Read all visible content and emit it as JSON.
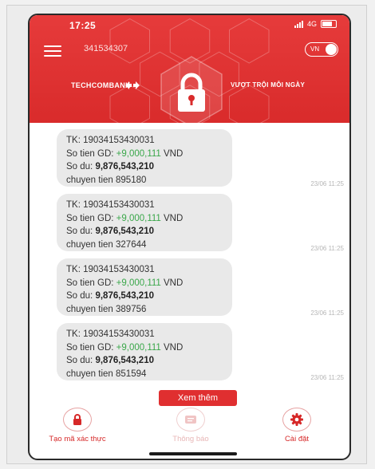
{
  "status_bar": {
    "time": "17:25",
    "network": "4G"
  },
  "header": {
    "account_number": "341534307",
    "language_toggle": "VN",
    "bank_name": "TECHCOMBANK",
    "slogan": "VƯỢT TRỘI MỖI NGÀY",
    "brand_color": "#e0302f"
  },
  "messages": [
    {
      "line_tk": "TK: 19034153430031",
      "gd_label": "So tien GD: ",
      "gd_amount": "+9,000,111",
      "gd_currency": " VND",
      "du_label": "So du: ",
      "balance": "9,876,543,210",
      "description": "chuyen tien 895180",
      "time": "23/06 11:25"
    },
    {
      "line_tk": "TK: 19034153430031",
      "gd_label": "So tien GD: ",
      "gd_amount": "+9,000,111",
      "gd_currency": " VND",
      "du_label": "So du: ",
      "balance": "9,876,543,210",
      "description": "chuyen tien 327644",
      "time": "23/06 11:25"
    },
    {
      "line_tk": "TK: 19034153430031",
      "gd_label": "So tien GD: ",
      "gd_amount": "+9,000,111",
      "gd_currency": " VND",
      "du_label": "So du: ",
      "balance": "9,876,543,210",
      "description": "chuyen tien 389756",
      "time": "23/06 11:25"
    },
    {
      "line_tk": "TK: 19034153430031",
      "gd_label": "So tien GD: ",
      "gd_amount": "+9,000,111",
      "gd_currency": " VND",
      "du_label": "So du: ",
      "balance": "9,876,543,210",
      "description": "chuyen tien 851594",
      "time": "23/06 11:25"
    }
  ],
  "more_button": "Xem thêm",
  "tabs": [
    {
      "label": "Tạo mã xác thực",
      "icon": "lock-icon"
    },
    {
      "label": "Thông báo",
      "icon": "message-icon"
    },
    {
      "label": "Cài đặt",
      "icon": "gear-icon"
    }
  ]
}
